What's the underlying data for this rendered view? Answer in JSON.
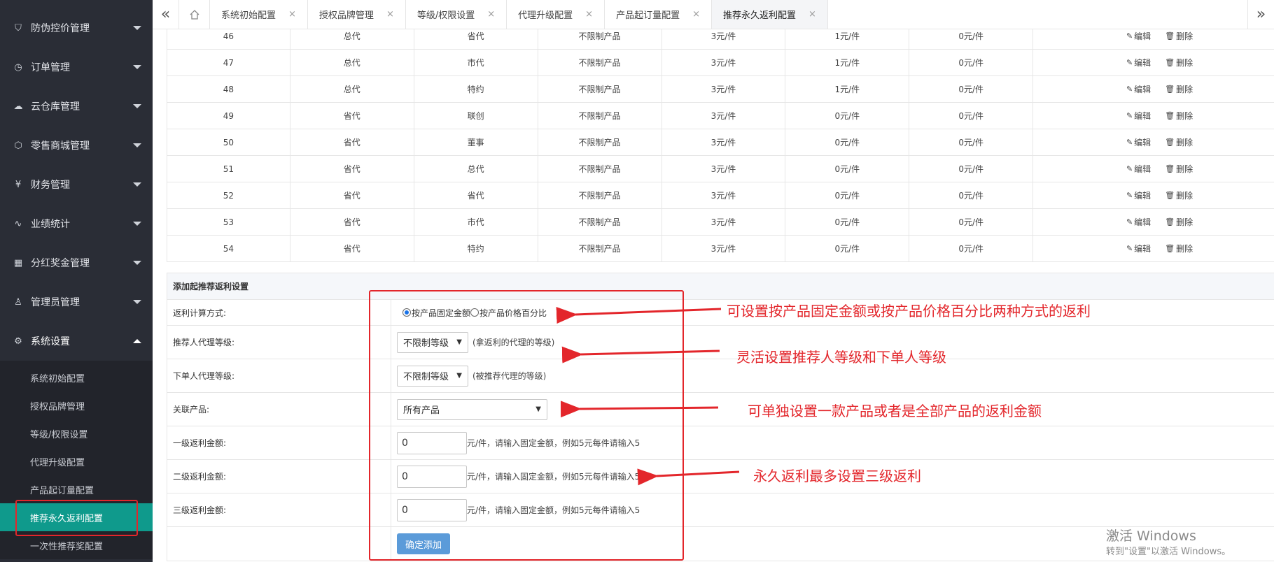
{
  "sidebar": {
    "menu": [
      {
        "label": "防伪控价管理",
        "icon": "shield-icon"
      },
      {
        "label": "订单管理",
        "icon": "order-icon"
      },
      {
        "label": "云仓库管理",
        "icon": "cloud-icon"
      },
      {
        "label": "零售商城管理",
        "icon": "box-icon"
      },
      {
        "label": "财务管理",
        "icon": "yen-icon"
      },
      {
        "label": "业绩统计",
        "icon": "pulse-icon"
      },
      {
        "label": "分红奖金管理",
        "icon": "grid-icon"
      },
      {
        "label": "管理员管理",
        "icon": "user-icon"
      },
      {
        "label": "系统设置",
        "icon": "gear-icon"
      }
    ],
    "submenu": [
      "系统初始配置",
      "授权品牌管理",
      "等级/权限设置",
      "代理升级配置",
      "产品起订量配置",
      "推荐永久返利配置",
      "一次性推荐奖配置"
    ],
    "active_sub": "推荐永久返利配置"
  },
  "tabs": [
    "系统初始配置",
    "授权品牌管理",
    "等级/权限设置",
    "代理升级配置",
    "产品起订量配置",
    "推荐永久返利配置"
  ],
  "table": {
    "rows": [
      [
        "46",
        "总代",
        "省代",
        "不限制产品",
        "3元/件",
        "1元/件",
        "0元/件"
      ],
      [
        "47",
        "总代",
        "市代",
        "不限制产品",
        "3元/件",
        "1元/件",
        "0元/件"
      ],
      [
        "48",
        "总代",
        "特约",
        "不限制产品",
        "3元/件",
        "1元/件",
        "0元/件"
      ],
      [
        "49",
        "省代",
        "联创",
        "不限制产品",
        "3元/件",
        "0元/件",
        "0元/件"
      ],
      [
        "50",
        "省代",
        "董事",
        "不限制产品",
        "3元/件",
        "0元/件",
        "0元/件"
      ],
      [
        "51",
        "省代",
        "总代",
        "不限制产品",
        "3元/件",
        "0元/件",
        "0元/件"
      ],
      [
        "52",
        "省代",
        "省代",
        "不限制产品",
        "3元/件",
        "0元/件",
        "0元/件"
      ],
      [
        "53",
        "省代",
        "市代",
        "不限制产品",
        "3元/件",
        "0元/件",
        "0元/件"
      ],
      [
        "54",
        "省代",
        "特约",
        "不限制产品",
        "3元/件",
        "0元/件",
        "0元/件"
      ]
    ],
    "edit_label": "编辑",
    "delete_label": "删除"
  },
  "form": {
    "title": "添加起推荐返利设置",
    "calc_label": "返利计算方式:",
    "radio_fixed": "按产品固定金额",
    "radio_percent": "按产品价格百分比",
    "referrer_label": "推荐人代理等级:",
    "referrer_value": "不限制等级",
    "referrer_hint": "(拿返利的代理的等级)",
    "buyer_label": "下单人代理等级:",
    "buyer_value": "不限制等级",
    "buyer_hint": "(被推荐代理的等级)",
    "product_label": "关联产品:",
    "product_value": "所有产品",
    "level1_label": "一级返利金额:",
    "level2_label": "二级返利金额:",
    "level3_label": "三级返利金额:",
    "amount_value": "0",
    "amount_hint": "元/件，请输入固定金额，例如5元每件请输入5",
    "submit": "确定添加"
  },
  "annotations": [
    "可设置按产品固定金额或按产品价格百分比两种方式的返利",
    "灵活设置推荐人等级和下单人等级",
    "可单独设置一款产品或者是全部产品的返利金额",
    "永久返利最多设置三级返利"
  ],
  "watermark": {
    "line1": "激活 Windows",
    "line2": "转到\"设置\"以激活 Windows。"
  },
  "colors": {
    "sidebar_bg": "#2a2d36",
    "active_teal": "#0f9a8c",
    "annotation_red": "#e3262b",
    "button_blue": "#5b9bd9"
  }
}
